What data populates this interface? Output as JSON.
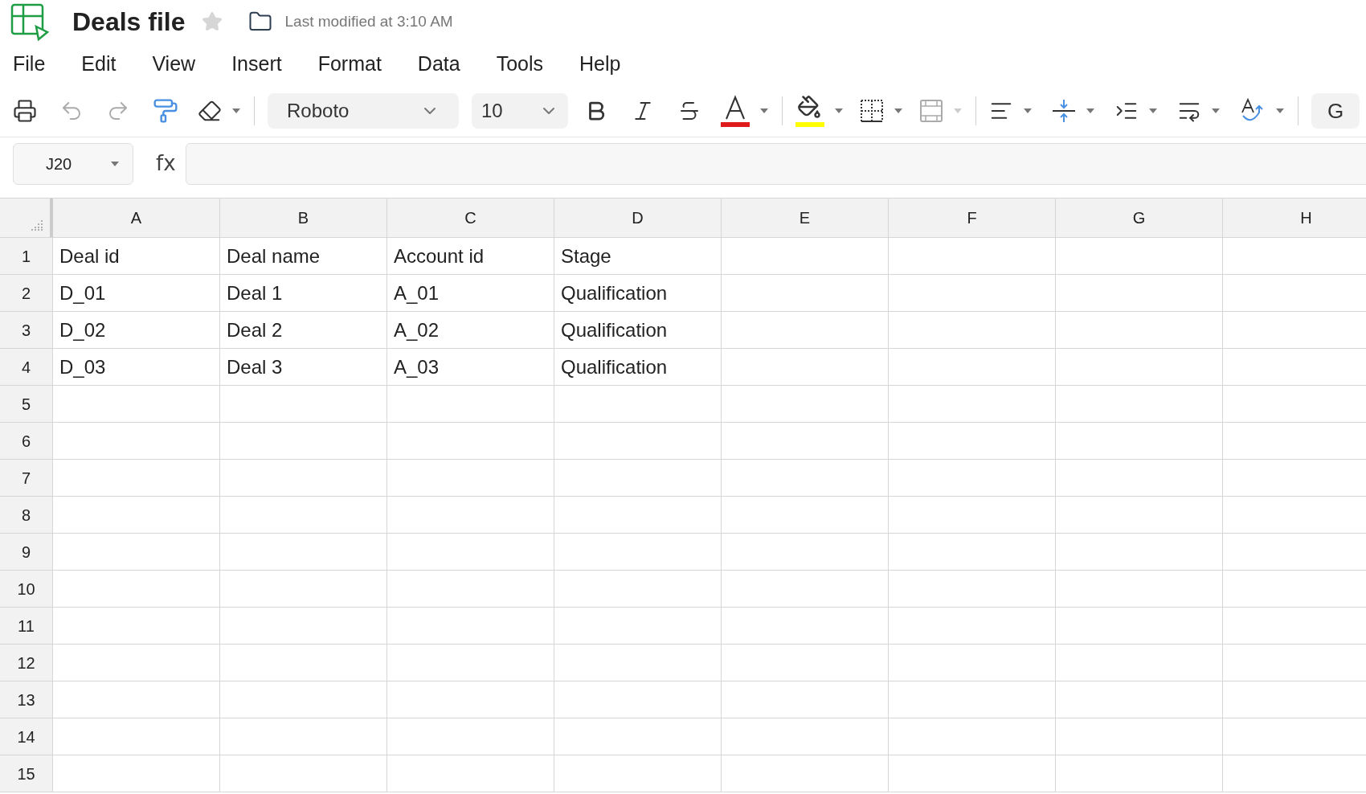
{
  "header": {
    "title": "Deals file",
    "starred": false,
    "last_modified": "Last modified at 3:10 AM"
  },
  "menu": [
    "File",
    "Edit",
    "View",
    "Insert",
    "Format",
    "Data",
    "Tools",
    "Help"
  ],
  "toolbar": {
    "font": "Roboto",
    "size": "10",
    "text_color": {
      "color": "#e01b1b"
    },
    "fill_color": {
      "color": "#ffff00"
    },
    "merge_disabled": true,
    "trailing_button": "G"
  },
  "formula_bar": {
    "cell_ref": "J20",
    "function_label": "fx"
  },
  "columns": [
    "A",
    "B",
    "C",
    "D",
    "E",
    "F",
    "G",
    "H"
  ],
  "rows": [
    {
      "number": "1",
      "cells": [
        "Deal id",
        "Deal name",
        "Account id",
        "Stage"
      ]
    },
    {
      "number": "2",
      "cells": [
        "D_01",
        "Deal 1",
        "A_01",
        "Qualification"
      ]
    },
    {
      "number": "3",
      "cells": [
        "D_02",
        "Deal 2",
        "A_02",
        "Qualification"
      ]
    },
    {
      "number": "4",
      "cells": [
        "D_03",
        "Deal 3",
        "A_03",
        "Qualification"
      ]
    },
    {
      "number": "5",
      "cells": []
    },
    {
      "number": "6",
      "cells": []
    },
    {
      "number": "7",
      "cells": []
    },
    {
      "number": "8",
      "cells": []
    },
    {
      "number": "9",
      "cells": []
    },
    {
      "number": "10",
      "cells": []
    },
    {
      "number": "11",
      "cells": []
    },
    {
      "number": "12",
      "cells": []
    },
    {
      "number": "13",
      "cells": []
    },
    {
      "number": "14",
      "cells": []
    },
    {
      "number": "15",
      "cells": []
    }
  ]
}
